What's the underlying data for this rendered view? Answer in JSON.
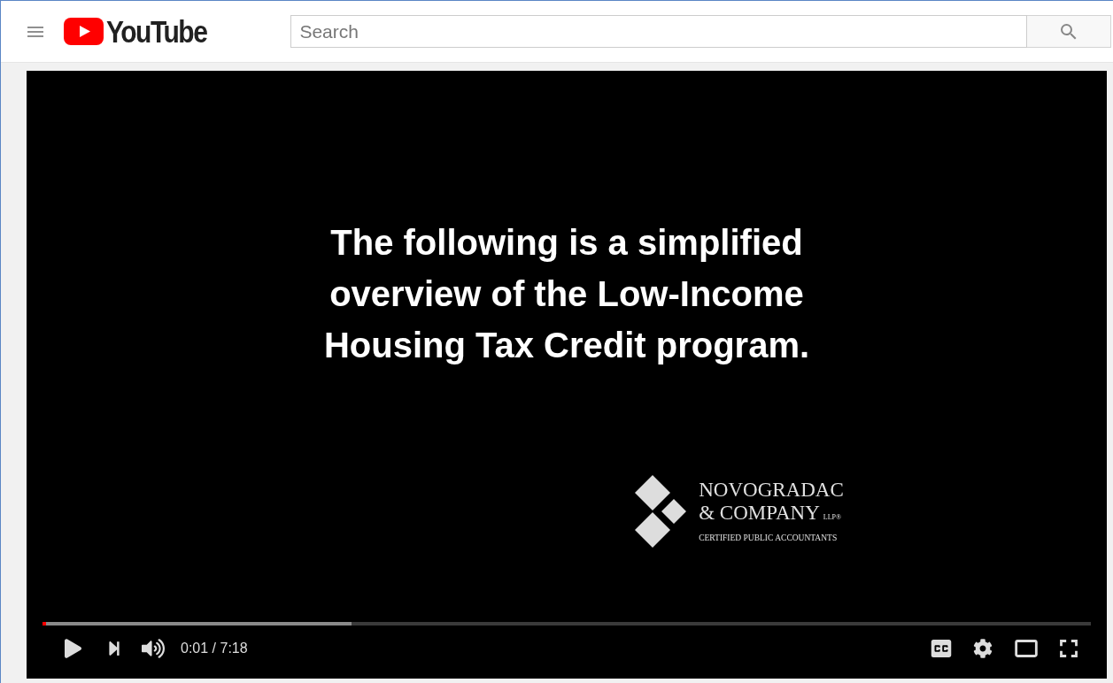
{
  "header": {
    "logo": "YouTube",
    "search": {
      "placeholder": "Search"
    }
  },
  "video": {
    "slide_text": "The following is a simplified overview of the Low-Income Housing Tax Credit program.",
    "logo": {
      "name_line_1": "NOVOGRADAC",
      "name_line_2": "& COMPANY",
      "suffix": "LLP®",
      "tagline": "CERTIFIED PUBLIC ACCOUNTANTS"
    }
  },
  "player": {
    "progress": {
      "played": {
        "level": 0.003
      },
      "buffered": {
        "level": 0.295
      }
    },
    "time": "0:01 / 7:18"
  }
}
